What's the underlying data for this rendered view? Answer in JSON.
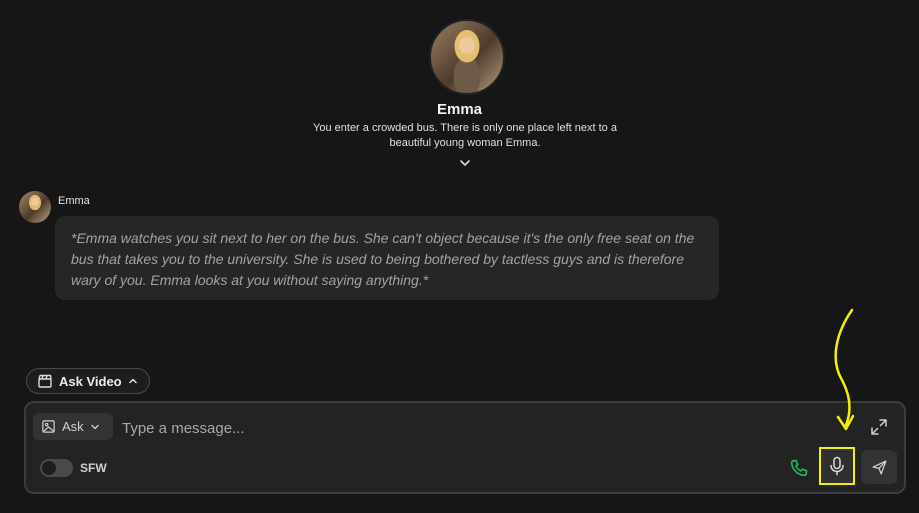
{
  "character": {
    "name": "Emma",
    "description": "You enter a crowded bus. There is only one place left next to a beautiful young woman Emma."
  },
  "messages": [
    {
      "sender": "Emma",
      "text": "*Emma watches you sit next to her on the bus. She can't object because it's the only free seat on the bus that takes you to the university. She is used to being bothered by tactless guys and is therefore wary of you. Emma looks at you without saying anything.*"
    }
  ],
  "ask_video": {
    "label": "Ask Video",
    "icon": "clapperboard-icon"
  },
  "composer": {
    "mode_label": "Ask",
    "placeholder": "Type a message...",
    "value": "",
    "sfw_label": "SFW",
    "sfw_enabled": false
  },
  "colors": {
    "background": "#161616",
    "bubble": "#262626",
    "phone": "#22c55e",
    "highlight": "#f2f200"
  },
  "icons": [
    "chevron-down-icon",
    "image-icon",
    "expand-icon",
    "phone-icon",
    "microphone-icon",
    "send-icon"
  ]
}
